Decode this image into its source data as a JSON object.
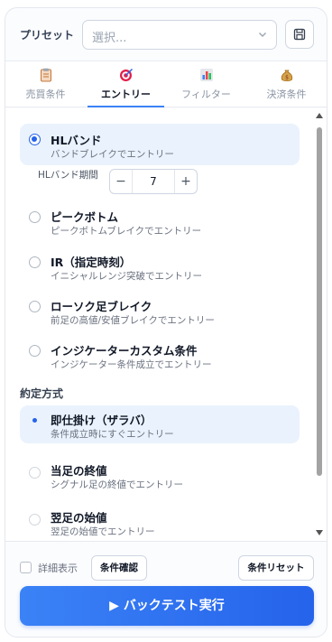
{
  "preset": {
    "label": "プリセット",
    "select_placeholder": "選択..."
  },
  "tabs": [
    {
      "label": "売買条件",
      "icon": "clipboard-icon"
    },
    {
      "label": "エントリー",
      "icon": "target-icon"
    },
    {
      "label": "フィルター",
      "icon": "bar-chart-icon"
    },
    {
      "label": "決済条件",
      "icon": "money-bag-icon"
    }
  ],
  "active_tab": "エントリー",
  "entry_types": [
    {
      "title": "HLバンド",
      "desc": "バンドブレイクでエントリー",
      "selected": true
    },
    {
      "title": "ピークボトム",
      "desc": "ピークボトムブレイクでエントリー",
      "selected": false
    },
    {
      "title": "IR（指定時刻）",
      "desc": "イニシャルレンジ突破でエントリー",
      "selected": false
    },
    {
      "title": "ローソク足ブレイク",
      "desc": "前足の高値/安値ブレイクでエントリー",
      "selected": false
    },
    {
      "title": "インジケーターカスタム条件",
      "desc": "インジケーター条件成立でエントリー",
      "selected": false
    }
  ],
  "hl_period": {
    "label": "HLバンド期間",
    "minus": "−",
    "value": "7",
    "plus": "+"
  },
  "execution": {
    "heading": "約定方式",
    "options": [
      {
        "title": "即仕掛け（ザラバ）",
        "desc": "条件成立時にすぐエントリー",
        "selected": true
      },
      {
        "title": "当足の終値",
        "desc": "シグナル足の終値でエントリー",
        "selected": false
      },
      {
        "title": "翌足の始値",
        "desc": "翌足の始値でエントリー",
        "selected": false
      }
    ]
  },
  "footer": {
    "detail_label": "詳細表示",
    "detail_checked": false,
    "check_button": "条件確認",
    "reset_button": "条件リセット",
    "run_button": "▶ バックテスト実行"
  },
  "colors": {
    "accent": "#2563eb",
    "selected_bg": "#eaf2fd"
  }
}
